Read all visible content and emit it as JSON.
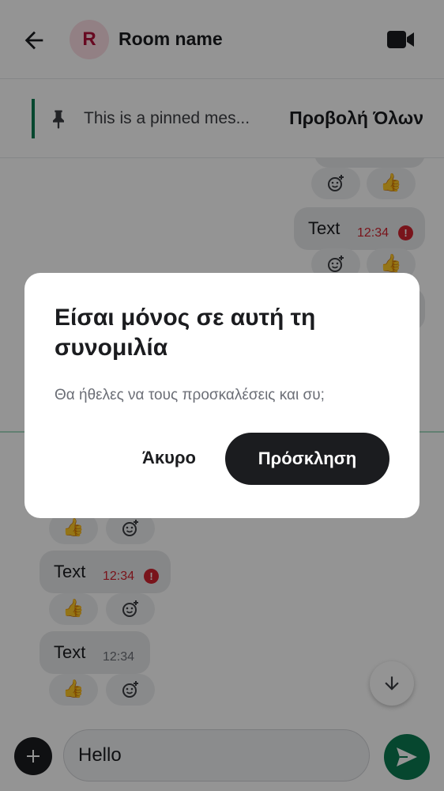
{
  "header": {
    "room_name": "Room name",
    "avatar_letter": "R",
    "back_icon": "arrow-left-icon",
    "video_icon": "video-camera-icon"
  },
  "pinned": {
    "text": "This is a pinned mes...",
    "view_all_label": "Προβολή Όλων",
    "icon": "pin-icon"
  },
  "messages_outgoing": [
    {
      "text": "Text",
      "time": "12:34",
      "failed": true
    }
  ],
  "messages_incoming": [
    {
      "text": "Text",
      "time": "12:34",
      "failed": true
    },
    {
      "text": "Text",
      "time": "12:34",
      "failed": false
    }
  ],
  "reactions": {
    "thumb": "👍",
    "add_icon": "add-reaction-icon"
  },
  "composer": {
    "value": "Hello",
    "attach_icon": "plus-icon",
    "send_icon": "send-icon"
  },
  "dialog": {
    "title": "Είσαι μόνος σε αυτή τη συνομιλία",
    "body": "Θα ήθελες να τους προσκαλέσεις και συ;",
    "cancel_label": "Άκυρο",
    "invite_label": "Πρόσκληση"
  },
  "colors": {
    "accent": "#0b7a52",
    "error": "#d1242f",
    "primary_button": "#1b1c1f",
    "avatar_bg": "#fcdce4",
    "avatar_text": "#b3103a"
  }
}
